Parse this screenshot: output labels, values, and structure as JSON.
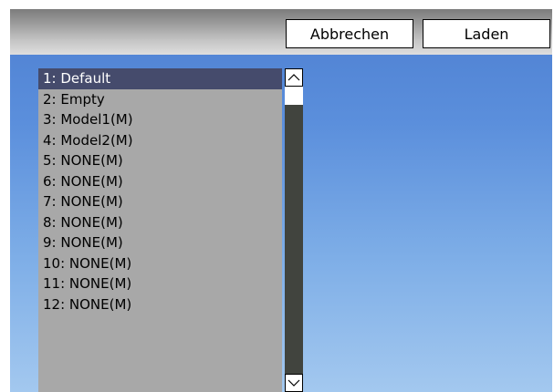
{
  "toolbar": {
    "cancel_label": "Abbrechen",
    "load_label": "Laden"
  },
  "model_list": {
    "selected_index": 0,
    "items": [
      "1: Default",
      "2: Empty",
      "3: Model1(M)",
      "4: Model2(M)",
      "5: NONE(M)",
      "6: NONE(M)",
      "7: NONE(M)",
      "8: NONE(M)",
      "9: NONE(M)",
      "10: NONE(M)",
      "11: NONE(M)",
      "12: NONE(M)"
    ]
  },
  "scrollbar": {
    "up_icon": "chevron-up-icon",
    "down_icon": "chevron-down-icon"
  },
  "colors": {
    "selection": "#454b6c",
    "list_background": "#a8a8a8",
    "scroll_track": "#41443e"
  }
}
